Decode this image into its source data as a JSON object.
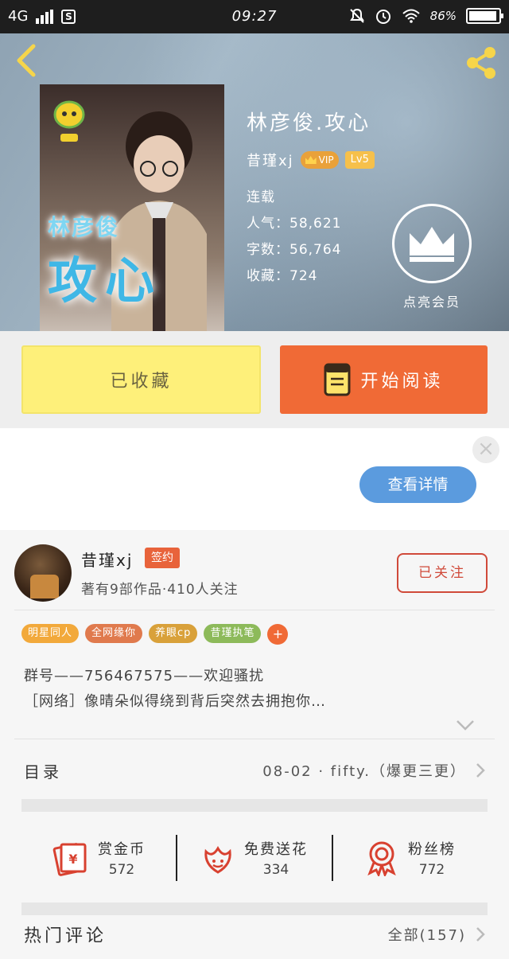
{
  "status_bar": {
    "network": "4G",
    "sim_icon": "S",
    "time": "09:27",
    "battery": "86%"
  },
  "book": {
    "cover_text_small": "林彦俊",
    "cover_text_large": "攻心",
    "title": "林彦俊.攻心",
    "author": "昔瑾xj",
    "vip_badge": "VIP",
    "level_badge": "Lv5",
    "status": "连载",
    "popularity": "人气：58,621",
    "word_count": "字数：56,764",
    "favorites": "收藏：724",
    "vip_prompt": "点亮会员"
  },
  "actions": {
    "collected_label": "已收藏",
    "read_label": "开始阅读"
  },
  "ad": {
    "close_icon": "×",
    "detail_label": "查看详情"
  },
  "author_card": {
    "name": "昔瑾xj",
    "signed_badge": "签约",
    "works_info": "著有9部作品·410人关注",
    "follow_label": "已关注",
    "tags": [
      {
        "label": "明星同人",
        "color": "#f2a93b"
      },
      {
        "label": "全网缘你",
        "color": "#e07a4d"
      },
      {
        "label": "养眼cp",
        "color": "#d9a13a"
      },
      {
        "label": "昔瑾执笔",
        "color": "#8dba5a"
      }
    ],
    "tag_more": "+",
    "intro_line1": "群号——756467575——欢迎骚扰",
    "intro_line2": "［网络］像晴朵似得绕到背后突然去拥抱你…"
  },
  "catalog": {
    "label": "目录",
    "latest": "08-02 · fifty.（爆更三更）"
  },
  "stats": [
    {
      "name": "赏金币",
      "value": "572",
      "icon": "red-envelope-icon"
    },
    {
      "name": "免费送花",
      "value": "334",
      "icon": "flower-icon"
    },
    {
      "name": "粉丝榜",
      "value": "772",
      "icon": "medal-icon"
    }
  ],
  "comments": {
    "label": "热门评论",
    "all": "全部(157)"
  },
  "colors": {
    "accent_orange": "#f06a36",
    "collected_yellow": "#fef07a",
    "detail_blue": "#5b9bde",
    "follow_red": "#d04a3a"
  }
}
